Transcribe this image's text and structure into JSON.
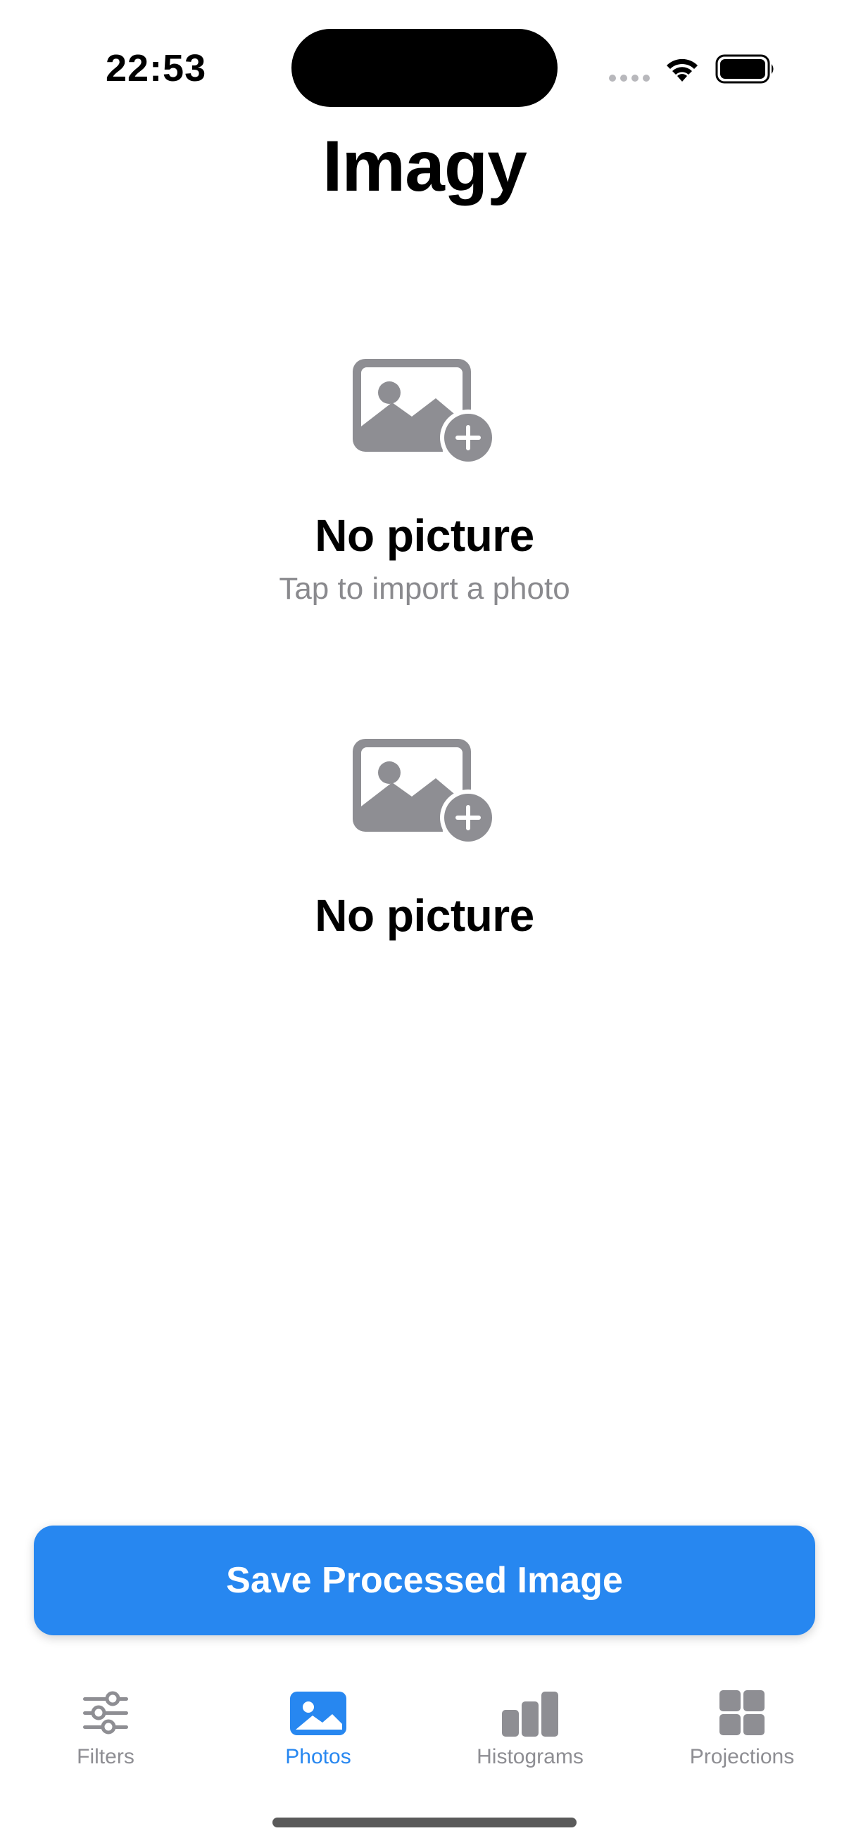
{
  "status_bar": {
    "time": "22:53"
  },
  "app": {
    "title": "Imagy"
  },
  "photo_slots": [
    {
      "icon": "photo-badge-plus-icon",
      "title": "No picture",
      "subtitle": "Tap to import a photo"
    },
    {
      "icon": "photo-badge-plus-icon",
      "title": "No picture"
    }
  ],
  "actions": {
    "save_label": "Save Processed Image"
  },
  "tab_bar": {
    "items": [
      {
        "label": "Filters",
        "icon": "sliders-icon",
        "active": false
      },
      {
        "label": "Photos",
        "icon": "photo-icon",
        "active": true
      },
      {
        "label": "Histograms",
        "icon": "bar-chart-icon",
        "active": false
      },
      {
        "label": "Projections",
        "icon": "grid-icon",
        "active": false
      }
    ]
  },
  "colors": {
    "accent": "#2787f0",
    "icon_gray": "#8e8e93",
    "secondary_text": "#8a8a8e"
  }
}
